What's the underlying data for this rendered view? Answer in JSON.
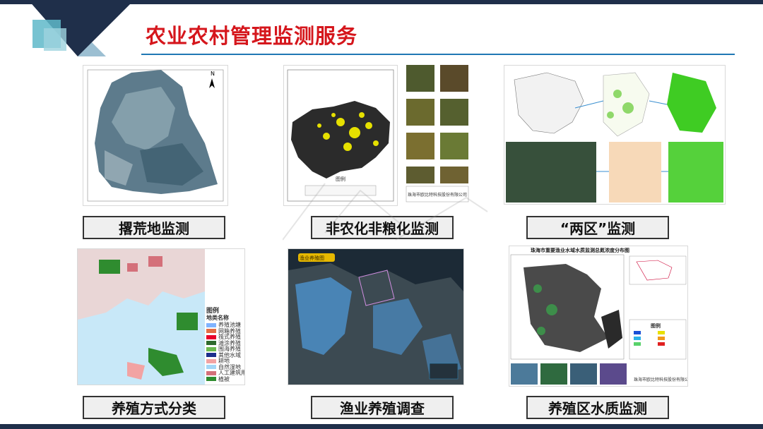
{
  "page": {
    "title": "农业农村管理监测服务"
  },
  "cards": [
    {
      "label": "撂荒地监测"
    },
    {
      "label": "非农化非粮化监测"
    },
    {
      "label": "“两区”监测"
    },
    {
      "label": "养殖方式分类"
    },
    {
      "label": "渔业养殖调查"
    },
    {
      "label": "养殖区水质监测"
    }
  ],
  "map_top_center": {
    "legend_title": "图例",
    "footer": "珠海市欧比特科技股份有限公司"
  },
  "map_bottom_left": {
    "legend_title": "图例",
    "legend_header": "地类名称",
    "legend_items": [
      "养殖池塘",
      "网箱养殖",
      "筏式养殖",
      "滩涂养殖",
      "围海养殖",
      "其他水域",
      "耕地",
      "自然湿地",
      "人工建筑用地",
      "植被"
    ],
    "legend_colors": [
      "#7fb3ff",
      "#e36d45",
      "#e8002a",
      "#2e6b2e",
      "#6aba4f",
      "#1c2e8c",
      "#f2a3a3",
      "#a3d6f7",
      "#d4707a",
      "#2f8c2f"
    ]
  },
  "map_bottom_center": {
    "badge": "渔业养殖图"
  },
  "map_bottom_right": {
    "title": "珠海市重要渔业水域水质监测总氮浓度分布图",
    "legend_title": "图例",
    "footer": "珠海市欧比特科技股份有限公司"
  },
  "colors": {
    "title_red": "#d5161c",
    "accent_blue": "#1f78b4",
    "dark_navy": "#1f2f4a",
    "teal": "#5fb8c9"
  }
}
